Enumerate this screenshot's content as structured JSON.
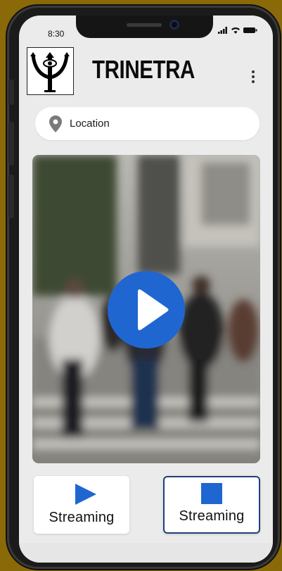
{
  "status_bar": {
    "time": "8:30"
  },
  "header": {
    "brand": "TRINETRA",
    "logo_icon": "trident-eye-logo",
    "menu_icon": "more-vertical-icon"
  },
  "location": {
    "label": "Location",
    "icon": "location-pin-icon"
  },
  "video": {
    "icon": "play-icon",
    "accent": "#1f66d1"
  },
  "controls": {
    "start": {
      "label": "Streaming",
      "icon": "play-triangle-icon",
      "color": "#1f66d1"
    },
    "stop": {
      "label": "Streaming",
      "icon": "stop-square-icon",
      "color": "#1f66d1"
    }
  }
}
